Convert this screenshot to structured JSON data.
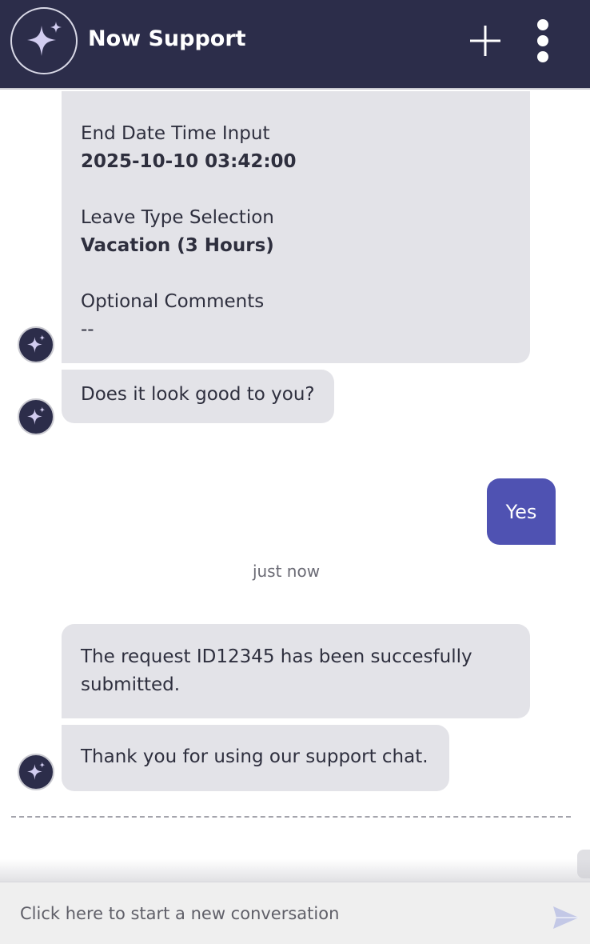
{
  "header": {
    "title": "Now Support",
    "new_chat_icon": "plus-icon",
    "menu_icon": "kebab-menu-icon",
    "brand_icon": "sparkle-icon"
  },
  "colors": {
    "header_bg": "#2c2d4a",
    "bot_bubble": "#e3e3e8",
    "user_bubble": "#4f52b2",
    "sparkle": "#d2cdf0"
  },
  "summary": {
    "fields": [
      {
        "label": "End Date Time Input",
        "value": "2025-10-10 03:42:00"
      },
      {
        "label": "Leave Type Selection",
        "value": "Vacation (3 Hours)"
      },
      {
        "label": "Optional Comments",
        "value": "--"
      }
    ]
  },
  "messages": {
    "confirm_question": "Does it look good to you?",
    "user_reply": "Yes",
    "timestamp": "just now",
    "submitted": "The request ID12345 has been succesfully submitted.",
    "thanks": "Thank you for using our support chat."
  },
  "input": {
    "placeholder": "Click here to start a new conversation",
    "send_icon": "send-icon"
  }
}
